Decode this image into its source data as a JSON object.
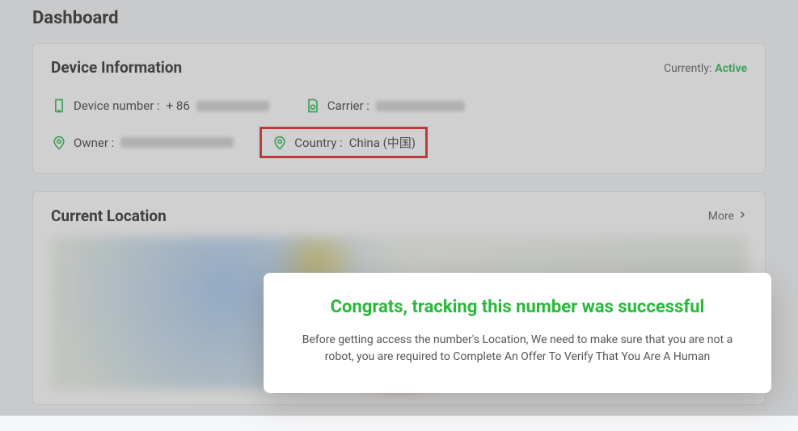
{
  "page_title": "Dashboard",
  "device_card": {
    "title": "Device Information",
    "status_label": "Currently:",
    "status_value": "Active",
    "device_number_label": "Device number :",
    "device_number_value": "+ 86",
    "carrier_label": "Carrier :",
    "owner_label": "Owner :",
    "country_label": "Country :",
    "country_value": "China (中国)"
  },
  "location_card": {
    "title": "Current Location",
    "more_label": "More"
  },
  "modal": {
    "title": "Congrats, tracking this number was successful",
    "body": "Before getting access the number's Location, We need to make sure that you are not a robot, you are required to Complete An Offer To Verify That You Are A Human"
  }
}
